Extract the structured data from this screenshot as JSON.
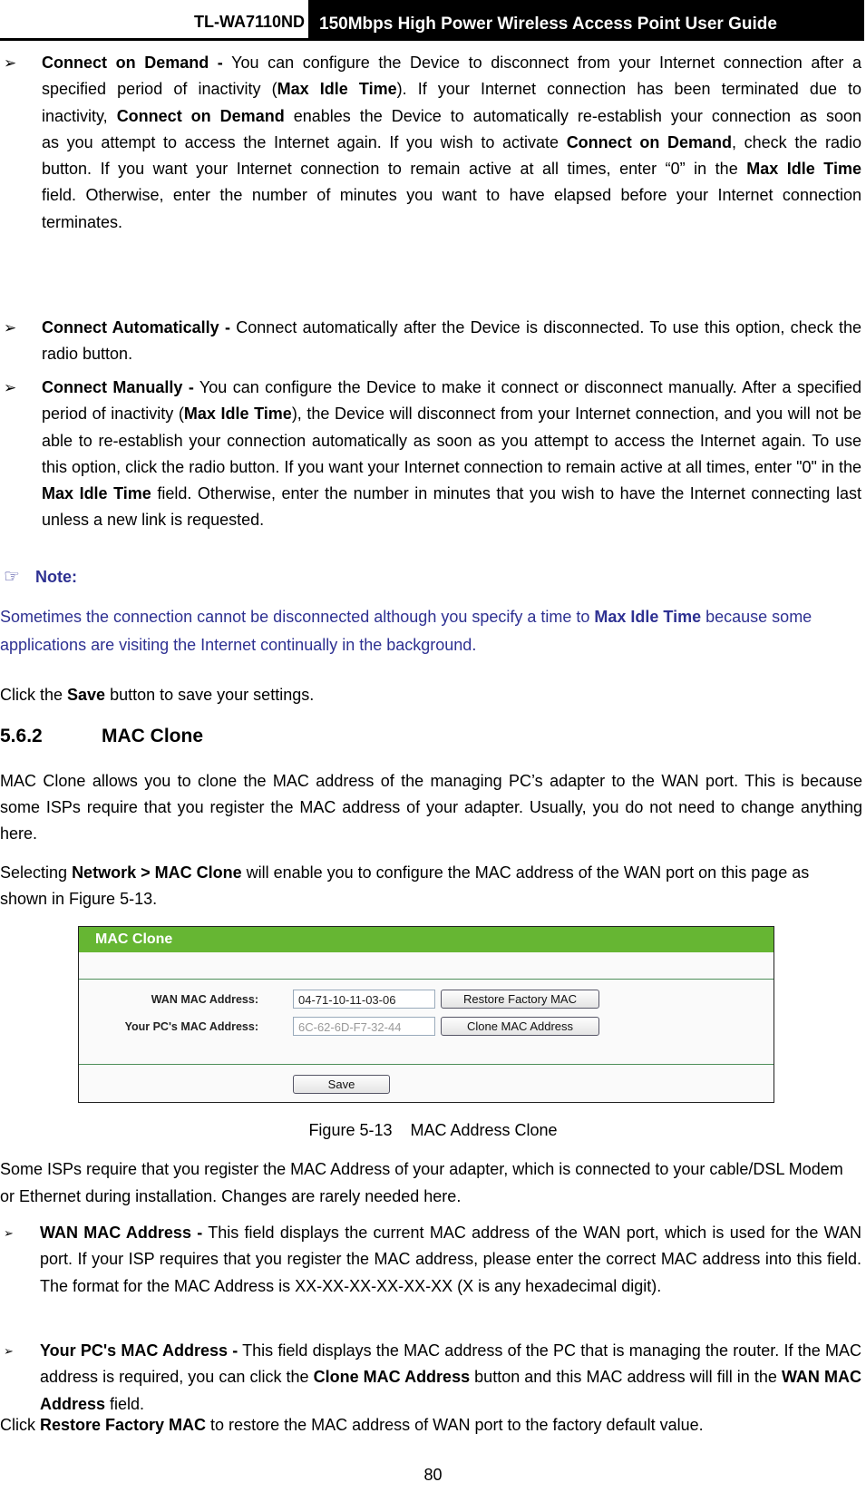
{
  "header": {
    "model": "TL-WA7110ND",
    "guide_title": "150Mbps High Power Wireless Access Point User Guide"
  },
  "bullets_top": [
    {
      "term": "Connect on Demand -",
      "text_html": "You can configure the Device to disconnect from your Internet connection after a specified period of inactivity (<b>Max Idle Time</b>). If your Internet connection has been terminated due to inactivity, <b>Connect on Demand</b> enables the Device to automatically re-establish your connection as soon as you attempt to access the Internet again. If you wish to activate <b>Connect on Demand</b>, check the radio button. If you want your Internet connection to remain active at all times, enter “0” in the <b>Max Idle Time</b> field. Otherwise, enter the number of minutes you want to have elapsed before your Internet connection terminates."
    },
    {
      "term": "Connect Automatically -",
      "text_html": "Connect automatically after the Device is disconnected. To use this option, check the radio button."
    },
    {
      "term": "Connect Manually -",
      "text_html": "You can configure the Device to make it connect or disconnect manually. After a specified period of inactivity (<b>Max Idle Time</b>), the Device will disconnect from your Internet connection, and you will not be able to re-establish your connection automatically as soon as you attempt to access the Internet again. To use this option, click the radio button. If you want your Internet connection to remain active at all times, enter \"0\" in the <b>Max Idle Time</b> field. Otherwise, enter the number in minutes that you wish to have the Internet connecting last unless a new link is requested."
    }
  ],
  "note": {
    "icon": "pointing-hand-icon",
    "title": "Note:",
    "text_html": "Sometimes the connection cannot be disconnected although you specify a time to <b>Max Idle Time</b> because some applications are visiting the Internet continually in the background.",
    "color": "#2e3192"
  },
  "save_instruction_html": "Click the <b>Save</b> button to save your settings.",
  "section": {
    "number": "5.6.2",
    "title": "MAC Clone"
  },
  "intro_html": "MAC Clone allows you to clone the MAC address of the managing PC’s adapter to the WAN port. This is because some ISPs require that you register the MAC address of your adapter. Usually, you do not need to change anything here.",
  "selecting_html": "Selecting <b>Network &gt; MAC Clone</b> will enable you to configure the MAC address of the WAN port on this page as shown in Figure 5-13.",
  "figure": {
    "panel_title": "MAC Clone",
    "accent": "#66b633",
    "wan_label": "WAN MAC Address:",
    "wan_value": "04-71-10-11-03-06",
    "pc_label": "Your PC's MAC Address:",
    "pc_value": "6C-62-6D-F7-32-44",
    "restore_button": "Restore Factory MAC",
    "clone_button": "Clone MAC Address",
    "save_button": "Save",
    "caption": "Figure 5-13    MAC Address Clone"
  },
  "isp_text": "Some ISPs require that you register the MAC Address of your adapter, which is connected to your cable/DSL Modem or Ethernet during installation. Changes are rarely needed here.",
  "bullets_bottom": [
    {
      "term": "WAN MAC Address -",
      "text_html": "This field displays the current MAC address of the WAN port, which is used for the WAN port. If your ISP requires that you register the MAC address, please enter the correct MAC address into this field. The format for the MAC Address is XX-XX-XX-XX-XX-XX (X is any hexadecimal digit)."
    },
    {
      "term": "Your PC's MAC Address -",
      "text_html": "This field displays the MAC address of the PC that is managing the router. If the MAC address is required, you can click the <b>Clone MAC Address</b> button and this MAC address will fill in the <b>WAN MAC Address</b> field."
    }
  ],
  "restore_text_html": "Click <b>Restore Factory MAC</b> to restore the MAC address of WAN port to the factory default value.",
  "page_number": "80"
}
